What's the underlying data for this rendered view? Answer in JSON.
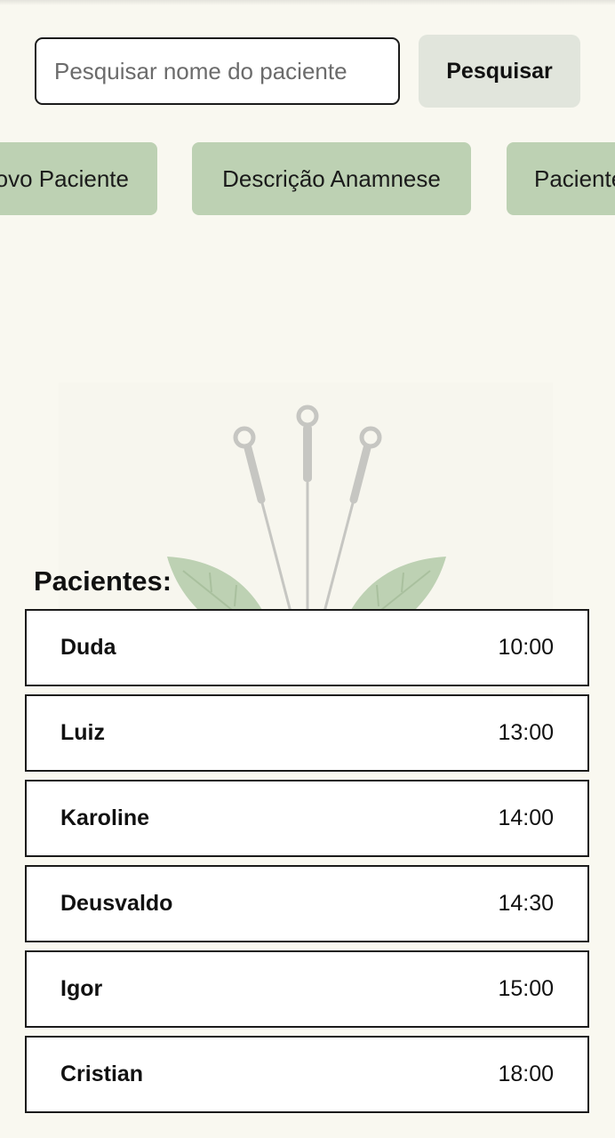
{
  "search": {
    "placeholder": "Pesquisar nome do paciente",
    "value": "",
    "button_label": "Pesquisar"
  },
  "actions": [
    {
      "label": "Novo Paciente"
    },
    {
      "label": "Descrição Anamnese"
    },
    {
      "label": "Pacientes"
    }
  ],
  "illustration": {
    "icon": "acupuncture-needles-leaves-icon"
  },
  "patients_section": {
    "title": "Pacientes:",
    "items": [
      {
        "name": "Duda",
        "time": "10:00"
      },
      {
        "name": "Luiz",
        "time": "13:00"
      },
      {
        "name": "Karoline",
        "time": "14:00"
      },
      {
        "name": "Deusvaldo",
        "time": "14:30"
      },
      {
        "name": "Igor",
        "time": "15:00"
      },
      {
        "name": "Cristian",
        "time": "18:00"
      }
    ]
  },
  "colors": {
    "background": "#f9f8f0",
    "action_button": "#bdd1b3",
    "search_button": "#e1e5dc",
    "leaf": "#bdd1b3",
    "needle": "#c8c8c4"
  }
}
